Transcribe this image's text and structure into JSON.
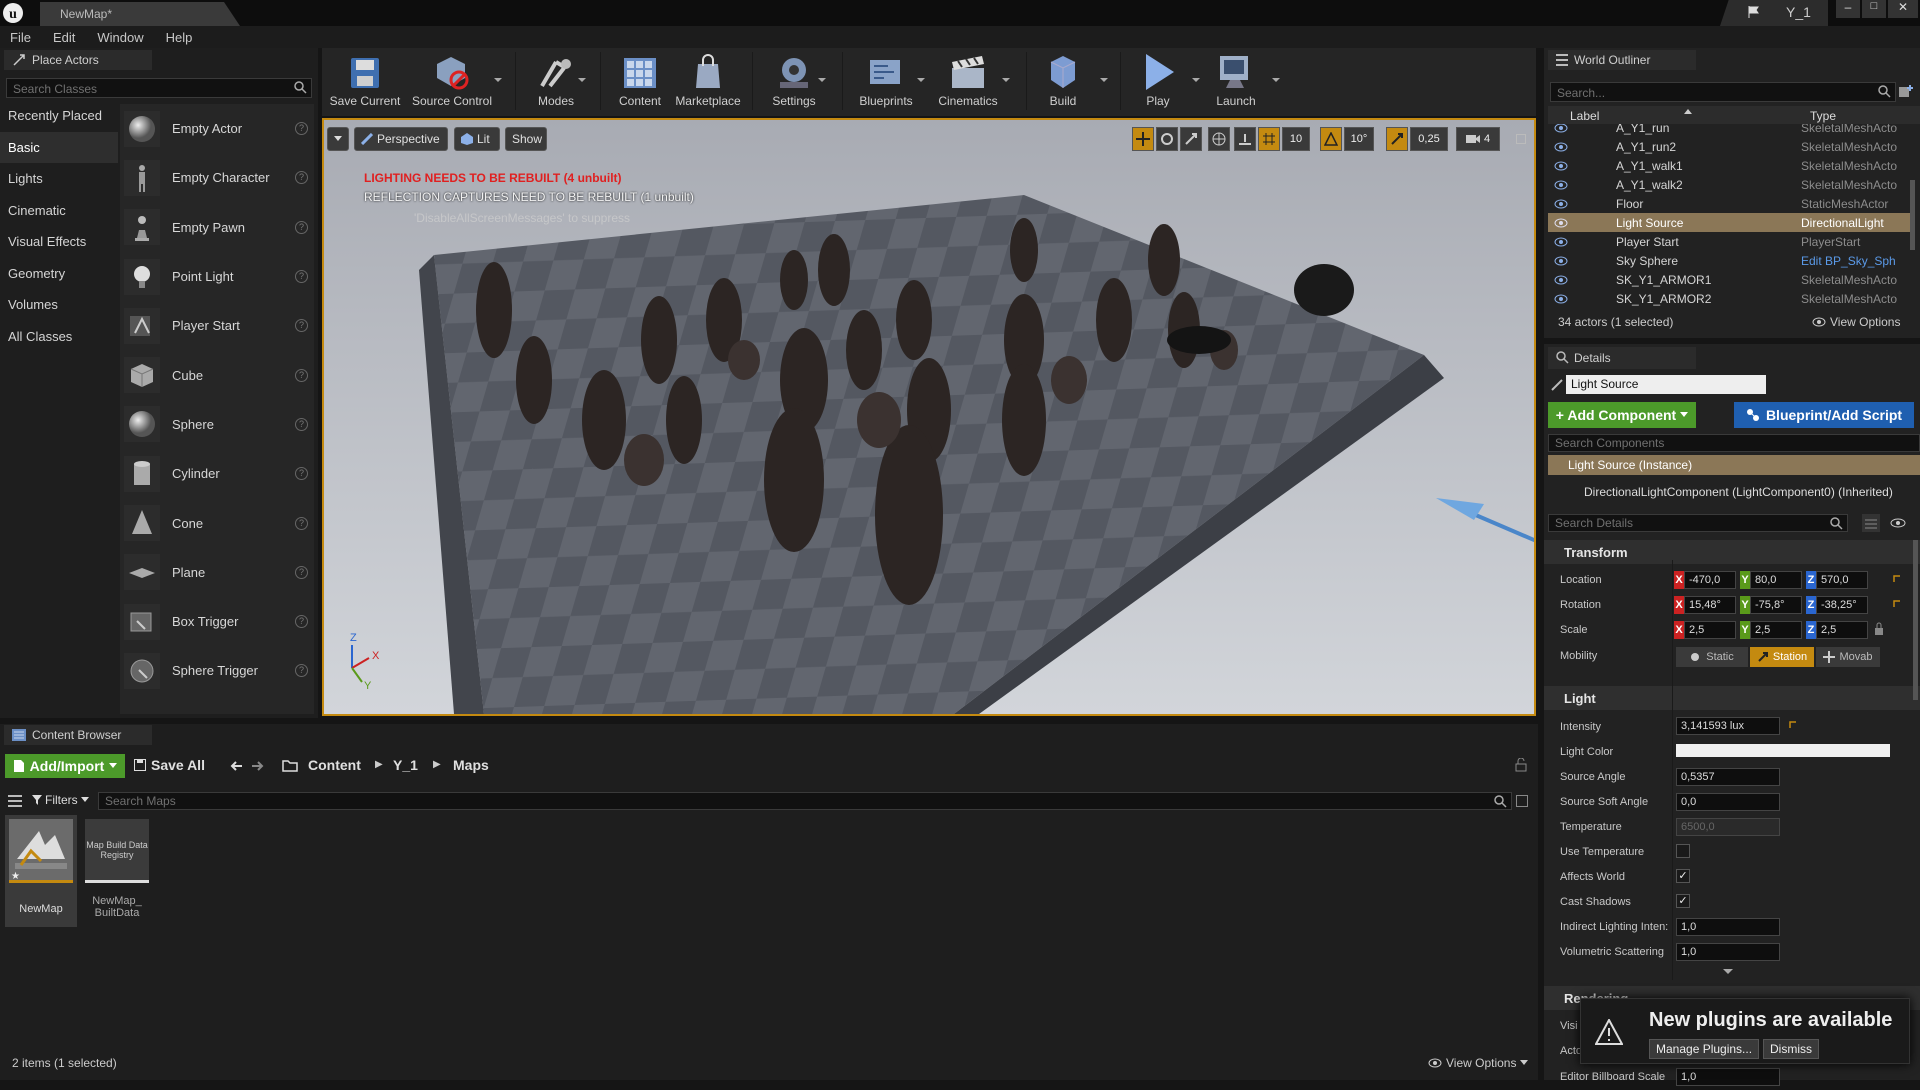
{
  "titlebar": {
    "tab": "NewMap*",
    "project": "Y_1"
  },
  "menu": [
    "File",
    "Edit",
    "Window",
    "Help"
  ],
  "place_actors": {
    "tab": "Place Actors",
    "search_placeholder": "Search Classes",
    "categories": [
      "Recently Placed",
      "Basic",
      "Lights",
      "Cinematic",
      "Visual Effects",
      "Geometry",
      "Volumes",
      "All Classes"
    ],
    "selected_category": "Basic",
    "items": [
      {
        "label": "Empty Actor",
        "icon": "sphere-icon"
      },
      {
        "label": "Empty Character",
        "icon": "character-icon"
      },
      {
        "label": "Empty Pawn",
        "icon": "pawn-icon"
      },
      {
        "label": "Point Light",
        "icon": "bulb-icon"
      },
      {
        "label": "Player Start",
        "icon": "player-start-icon"
      },
      {
        "label": "Cube",
        "icon": "cube-icon"
      },
      {
        "label": "Sphere",
        "icon": "sphere-icon"
      },
      {
        "label": "Cylinder",
        "icon": "cylinder-icon"
      },
      {
        "label": "Cone",
        "icon": "cone-icon"
      },
      {
        "label": "Plane",
        "icon": "plane-icon"
      },
      {
        "label": "Box Trigger",
        "icon": "box-trigger-icon"
      },
      {
        "label": "Sphere Trigger",
        "icon": "sphere-trigger-icon"
      }
    ]
  },
  "toolbar": {
    "buttons": [
      {
        "label": "Save Current",
        "icon": "save-icon"
      },
      {
        "label": "Source Control",
        "icon": "source-control-icon"
      },
      {
        "label": "Modes",
        "icon": "modes-icon"
      },
      {
        "label": "Content",
        "icon": "content-icon"
      },
      {
        "label": "Marketplace",
        "icon": "marketplace-icon"
      },
      {
        "label": "Settings",
        "icon": "settings-icon"
      },
      {
        "label": "Blueprints",
        "icon": "blueprints-icon"
      },
      {
        "label": "Cinematics",
        "icon": "cinematics-icon"
      },
      {
        "label": "Build",
        "icon": "build-icon"
      },
      {
        "label": "Play",
        "icon": "play-icon"
      },
      {
        "label": "Launch",
        "icon": "launch-icon"
      }
    ]
  },
  "viewport": {
    "perspective": "Perspective",
    "lit": "Lit",
    "show": "Show",
    "grid_snap": "10",
    "rot_snap": "10°",
    "scale_snap": "0,25",
    "camera_speed": "4",
    "warn1": "LIGHTING NEEDS TO BE REBUILT (4 unbuilt)",
    "warn2": "REFLECTION CAPTURES NEED TO BE REBUILT (1 unbuilt)",
    "warn3": "'DisableAllScreenMessages' to suppress",
    "axis_x": "X",
    "axis_y": "Y",
    "axis_z": "Z"
  },
  "outliner": {
    "tab": "World Outliner",
    "search_placeholder": "Search...",
    "col_label": "Label",
    "col_type": "Type",
    "rows": [
      {
        "label": "A_Y1_run",
        "type": "SkeletalMeshActo"
      },
      {
        "label": "A_Y1_run2",
        "type": "SkeletalMeshActo"
      },
      {
        "label": "A_Y1_walk1",
        "type": "SkeletalMeshActo"
      },
      {
        "label": "A_Y1_walk2",
        "type": "SkeletalMeshActo"
      },
      {
        "label": "Floor",
        "type": "StaticMeshActor"
      },
      {
        "label": "Light Source",
        "type": "DirectionalLight",
        "selected": true
      },
      {
        "label": "Player Start",
        "type": "PlayerStart"
      },
      {
        "label": "Sky Sphere",
        "type": "Edit BP_Sky_Sph"
      },
      {
        "label": "SK_Y1_ARMOR1",
        "type": "SkeletalMeshActo"
      },
      {
        "label": "SK_Y1_ARMOR2",
        "type": "SkeletalMeshActo"
      }
    ],
    "status": "34 actors (1 selected)",
    "view_options": "View Options"
  },
  "details": {
    "tab": "Details",
    "name": "Light Source",
    "add_component": "+ Add Component",
    "blueprint": "Blueprint/Add Script",
    "search_components": "Search Components",
    "instance": "Light Source (Instance)",
    "component": "DirectionalLightComponent (LightComponent0) (Inherited)",
    "search_details": "Search Details",
    "transform": "Transform",
    "location_label": "Location",
    "rotation_label": "Rotation",
    "scale_label": "Scale",
    "mobility_label": "Mobility",
    "location": [
      "-470,0",
      "80,0",
      "570,0"
    ],
    "rotation": [
      "15,48°",
      "-75,8°",
      "-38,25°"
    ],
    "scale": [
      "2,5",
      "2,5",
      "2,5"
    ],
    "mobility": [
      "Static",
      "Station",
      "Movab"
    ],
    "light": "Light",
    "intensity_label": "Intensity",
    "intensity": "3,141593 lux",
    "light_color_label": "Light Color",
    "source_angle_label": "Source Angle",
    "source_angle": "0,5357",
    "source_soft_angle_label": "Source Soft Angle",
    "source_soft_angle": "0,0",
    "temperature_label": "Temperature",
    "temperature": "6500,0",
    "use_temperature_label": "Use Temperature",
    "affects_world_label": "Affects World",
    "cast_shadows_label": "Cast Shadows",
    "indirect_label": "Indirect Lighting Inten:",
    "indirect": "1,0",
    "volumetric_label": "Volumetric Scattering",
    "volumetric": "1,0",
    "rendering": "Rendering",
    "visible_label": "Visi",
    "actor_hidden_label": "Acto",
    "billboard_label": "Editor Billboard Scale",
    "billboard": "1,0"
  },
  "content_browser": {
    "tab": "Content Browser",
    "add_import": "Add/Import",
    "save_all": "Save All",
    "path": [
      "Content",
      "Y_1",
      "Maps"
    ],
    "filters": "Filters",
    "search_placeholder": "Search Maps",
    "assets": [
      {
        "name": "NewMap",
        "thumb": ""
      },
      {
        "name": "NewMap_\nBuiltData",
        "thumb": "Map Build Data Registry"
      }
    ],
    "status": "2 items (1 selected)",
    "view_options": "View Options"
  },
  "notification": {
    "text": "New plugins are available",
    "manage": "Manage Plugins...",
    "dismiss": "Dismiss"
  },
  "colors": {
    "accent_green": "#4c9a2a",
    "blueprint_blue": "#1f5fb0",
    "selection": "#8b7757",
    "axis_x": "#c22",
    "axis_y": "#5a9a1a",
    "axis_z": "#2a66d0",
    "warning_red": "#e02020"
  }
}
